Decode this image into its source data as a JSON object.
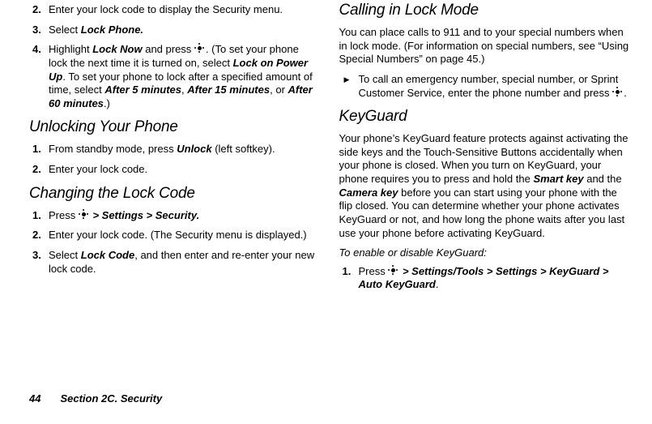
{
  "left": {
    "lock_steps": [
      "Enter your lock code to display the Security menu.",
      {
        "pre": "Select ",
        "b": "Lock Phone."
      },
      {
        "pre": "Highlight ",
        "b": "Lock Now",
        "mid": " and press ",
        "icon": true,
        "post": ". (To set your phone lock the next time it is turned on, select ",
        "b2": "Lock on Power Up",
        "post2": ". To set your phone to lock after a specified amount of time, select ",
        "b3": "After 5 minutes",
        "sep1": ", ",
        "b4": "After 15 minutes",
        "sep2": ", or ",
        "b5": "After 60 minutes",
        "end2": ".)"
      }
    ],
    "h_unlock": "Unlocking Your Phone",
    "unlock_steps": [
      {
        "pre": "From standby mode, press ",
        "b": "Unlock",
        "post": " (left softkey)."
      },
      "Enter your lock code."
    ],
    "h_change": "Changing the Lock Code",
    "change_steps": [
      {
        "pre": "Press ",
        "icon": true,
        "b": " > Settings > Security."
      },
      "Enter your lock code. (The Security menu is displayed.)",
      {
        "pre": "Select ",
        "b": "Lock Code",
        "post": ", and then enter and re-enter your new lock code."
      }
    ]
  },
  "right": {
    "h_call": "Calling in Lock Mode",
    "call_para": "You can place calls to 911 and to your special numbers when in lock mode. (For information on special numbers, see “Using Special Numbers” on page 45.)",
    "call_arrow": {
      "text": "To call an emergency number, special number, or Sprint Customer Service, enter the phone number and press ",
      "icon": true,
      "end": "."
    },
    "h_kg": "KeyGuard",
    "kg_para": {
      "a": "Your phone’s KeyGuard feature protects against activating the side keys and the Touch-Sensitive Buttons accidentally when your phone is closed. When you turn on KeyGuard, your phone requires you to press and hold the ",
      "b1": "Smart key",
      "b": " and the ",
      "b2": "Camera key",
      "c": " before you can start using your phone with the flip closed. You can determine whether your phone activates KeyGuard or not, and how long the phone waits after you last use your phone before activating KeyGuard."
    },
    "kg_sub": "To enable or disable KeyGuard:",
    "kg_steps": [
      {
        "pre": "Press ",
        "icon": true,
        "b": " > Settings/Tools > Settings > KeyGuard > Auto KeyGuard",
        "post": "."
      }
    ]
  },
  "footer": {
    "page": "44",
    "section": "Section 2C. Security"
  }
}
